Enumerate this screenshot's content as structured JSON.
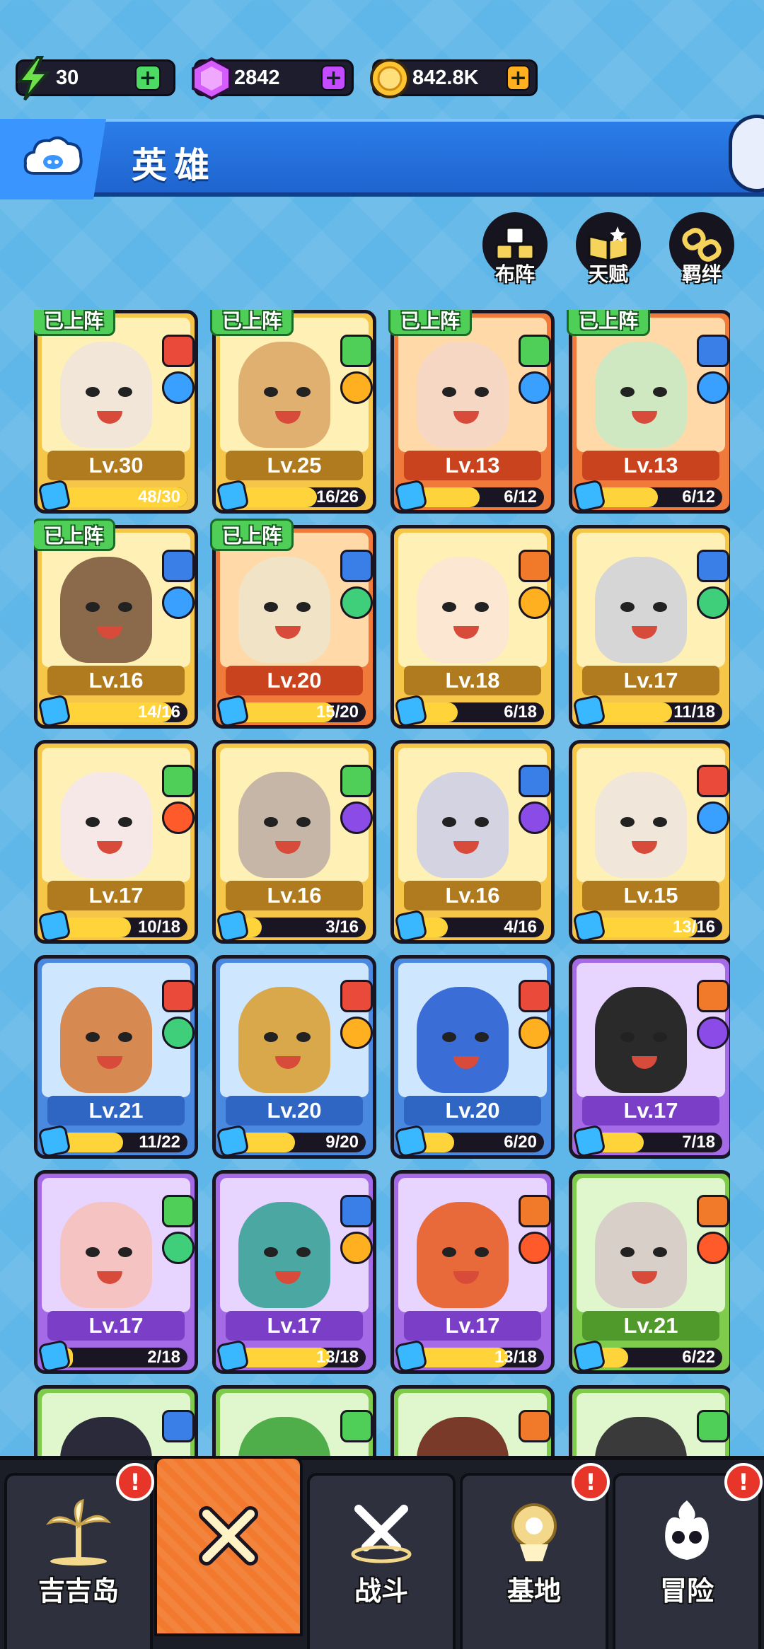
{
  "resources": {
    "energy": {
      "value": "30",
      "icon": "lightning-icon",
      "color": "#4cd964"
    },
    "gems": {
      "value": "2842",
      "icon": "gem-icon",
      "color": "#c44bff"
    },
    "coins": {
      "value": "842.8K",
      "icon": "coin-icon",
      "color": "#ffb020"
    }
  },
  "header": {
    "title": "英雄",
    "icon": "pig-cloud-icon"
  },
  "actions": [
    {
      "label": "布阵",
      "icon": "formation-icon"
    },
    {
      "label": "天赋",
      "icon": "talent-book-icon"
    },
    {
      "label": "羁绊",
      "icon": "bond-link-icon"
    }
  ],
  "deployed_label": "已上阵",
  "heroes": [
    {
      "level": "Lv.30",
      "progress": "48/30",
      "fraction": 1.0,
      "rarity": "gold",
      "deployed": true,
      "top_badge": "sword",
      "bottom_badge": "water"
    },
    {
      "level": "Lv.25",
      "progress": "16/26",
      "fraction": 0.62,
      "rarity": "gold",
      "deployed": true,
      "top_badge": "paw",
      "bottom_badge": "fire-swirl"
    },
    {
      "level": "Lv.13",
      "progress": "6/12",
      "fraction": 0.5,
      "rarity": "red",
      "deployed": true,
      "top_badge": "paw",
      "bottom_badge": "water"
    },
    {
      "level": "Lv.13",
      "progress": "6/12",
      "fraction": 0.5,
      "rarity": "red",
      "deployed": true,
      "top_badge": "hammer",
      "bottom_badge": "water"
    },
    {
      "level": "Lv.16",
      "progress": "14/16",
      "fraction": 0.88,
      "rarity": "gold",
      "deployed": true,
      "top_badge": "hammer",
      "bottom_badge": "water"
    },
    {
      "level": "Lv.20",
      "progress": "15/20",
      "fraction": 0.75,
      "rarity": "red",
      "deployed": true,
      "top_badge": "hammer",
      "bottom_badge": "lightning"
    },
    {
      "level": "Lv.18",
      "progress": "6/18",
      "fraction": 0.33,
      "rarity": "gold",
      "deployed": false,
      "top_badge": "bolt",
      "bottom_badge": "fire-swirl"
    },
    {
      "level": "Lv.17",
      "progress": "11/18",
      "fraction": 0.61,
      "rarity": "gold",
      "deployed": false,
      "top_badge": "hammer",
      "bottom_badge": "lightning"
    },
    {
      "level": "Lv.17",
      "progress": "10/18",
      "fraction": 0.56,
      "rarity": "gold",
      "deployed": false,
      "top_badge": "paw",
      "bottom_badge": "flame"
    },
    {
      "level": "Lv.16",
      "progress": "3/16",
      "fraction": 0.19,
      "rarity": "gold",
      "deployed": false,
      "top_badge": "paw",
      "bottom_badge": "eye"
    },
    {
      "level": "Lv.16",
      "progress": "4/16",
      "fraction": 0.25,
      "rarity": "gold",
      "deployed": false,
      "top_badge": "hammer",
      "bottom_badge": "eye"
    },
    {
      "level": "Lv.15",
      "progress": "13/16",
      "fraction": 0.81,
      "rarity": "gold",
      "deployed": false,
      "top_badge": "sword",
      "bottom_badge": "water"
    },
    {
      "level": "Lv.21",
      "progress": "11/22",
      "fraction": 0.5,
      "rarity": "blue",
      "deployed": false,
      "top_badge": "sword",
      "bottom_badge": "lightning"
    },
    {
      "level": "Lv.20",
      "progress": "9/20",
      "fraction": 0.45,
      "rarity": "blue",
      "deployed": false,
      "top_badge": "sword",
      "bottom_badge": "fire-swirl"
    },
    {
      "level": "Lv.20",
      "progress": "6/20",
      "fraction": 0.3,
      "rarity": "blue",
      "deployed": false,
      "top_badge": "sword",
      "bottom_badge": "fire-swirl"
    },
    {
      "level": "Lv.17",
      "progress": "7/18",
      "fraction": 0.39,
      "rarity": "purple",
      "deployed": false,
      "top_badge": "bolt",
      "bottom_badge": "eye"
    },
    {
      "level": "Lv.17",
      "progress": "2/18",
      "fraction": 0.11,
      "rarity": "purple",
      "deployed": false,
      "top_badge": "paw",
      "bottom_badge": "lightning"
    },
    {
      "level": "Lv.17",
      "progress": "13/18",
      "fraction": 0.72,
      "rarity": "purple",
      "deployed": false,
      "top_badge": "hammer",
      "bottom_badge": "fire-swirl"
    },
    {
      "level": "Lv.17",
      "progress": "13/18",
      "fraction": 0.72,
      "rarity": "purple",
      "deployed": false,
      "top_badge": "bolt",
      "bottom_badge": "flame"
    },
    {
      "level": "Lv.21",
      "progress": "6/22",
      "fraction": 0.27,
      "rarity": "green",
      "deployed": false,
      "top_badge": "bolt",
      "bottom_badge": "flame"
    },
    {
      "level": "",
      "progress": "",
      "fraction": 0.0,
      "rarity": "green",
      "deployed": false,
      "top_badge": "hammer",
      "bottom_badge": ""
    },
    {
      "level": "",
      "progress": "",
      "fraction": 0.0,
      "rarity": "green",
      "deployed": false,
      "top_badge": "paw",
      "bottom_badge": ""
    },
    {
      "level": "",
      "progress": "",
      "fraction": 0.0,
      "rarity": "green",
      "deployed": false,
      "top_badge": "bolt",
      "bottom_badge": ""
    },
    {
      "level": "",
      "progress": "",
      "fraction": 0.0,
      "rarity": "green",
      "deployed": false,
      "top_badge": "paw",
      "bottom_badge": ""
    }
  ],
  "nav": [
    {
      "label": "吉吉岛",
      "icon": "palm-island-icon",
      "alert": "!"
    },
    {
      "label": "",
      "icon": "close-x-icon",
      "alert": "",
      "active": true
    },
    {
      "label": "战斗",
      "icon": "crossed-swords-icon",
      "alert": ""
    },
    {
      "label": "基地",
      "icon": "base-tower-icon",
      "alert": "!"
    },
    {
      "label": "冒险",
      "icon": "skull-flame-icon",
      "alert": "!"
    }
  ]
}
